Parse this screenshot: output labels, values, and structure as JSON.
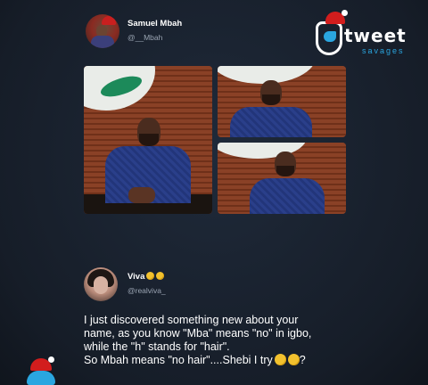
{
  "brand": {
    "logo_text": "tweet",
    "logo_subtext": "savages"
  },
  "tweet1": {
    "author_name": "Samuel Mbah",
    "author_handle": "@__Mbah"
  },
  "tweet2": {
    "author_name": "Viva",
    "author_handle": "@realviva_",
    "body_lines": [
      "I just discovered something new about your",
      "name, as you know \"Mba\" means \"no\" in igbo,",
      "while the \"h\" stands for \"hair\".",
      "So Mbah means \"no hair\"....Shebi I try"
    ],
    "body_end": "?"
  },
  "colors": {
    "background": "#1b2330",
    "text": "#ffffff",
    "handle": "#9aa4b2",
    "brand_blue": "#2aa6e0",
    "brand_red": "#d21d1d"
  },
  "icons": {
    "tweet1_avatar": "profile-photo",
    "tweet2_avatar": "profile-photo",
    "name_emojis": [
      "crown-emoji",
      "crown-emoji"
    ],
    "end_emojis": [
      "hugging-face-emoji",
      "hugging-face-emoji"
    ]
  }
}
